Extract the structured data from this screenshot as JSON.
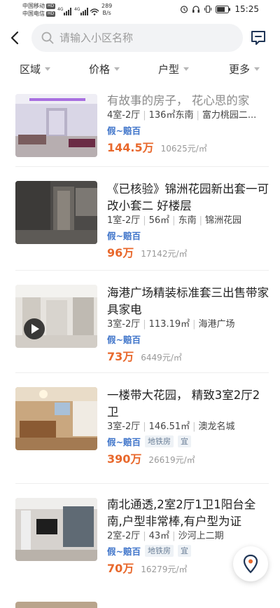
{
  "status_bar": {
    "carrier1": "中国移动",
    "carrier1_badge": "HD",
    "carrier2": "中国电信",
    "carrier2_badge": "HD",
    "net_speed_value": "289",
    "net_speed_unit": "B/s",
    "time": "15:25"
  },
  "search": {
    "placeholder": "请输入小区名称",
    "value": ""
  },
  "filters": [
    {
      "label": "区域"
    },
    {
      "label": "价格"
    },
    {
      "label": "户型"
    },
    {
      "label": "更多"
    }
  ],
  "listings": [
    {
      "title": "有故事的房子， 花心思的家",
      "layout": "4室-2厅",
      "area": "136㎡",
      "orientation": "东南",
      "community": "富力桃园二...",
      "guarantee": "假~赔百",
      "price": "144.5万",
      "unit_price": "10625元/㎡"
    },
    {
      "title": "《已核验》锦洲花园新出套一可改小套二 好楼层",
      "layout": "1室-2厅",
      "area": "56㎡",
      "orientation": "东南",
      "community": "锦洲花园",
      "guarantee": "假~赔百",
      "price": "96万",
      "unit_price": "17142元/㎡"
    },
    {
      "title": "海港广场精装标准套三出售带家具家电",
      "layout": "3室-2厅",
      "area": "113.19㎡",
      "community": "海港广场",
      "guarantee": "假~赔百",
      "price": "73万",
      "unit_price": "6449元/㎡",
      "has_video": true
    },
    {
      "title": "一楼带大花园， 精致3室2厅2卫",
      "layout": "3室-2厅",
      "area": "146.51㎡",
      "community": "澳龙名城",
      "guarantee": "假~赔百",
      "tag1": "地铁房",
      "tag2": "宜",
      "price": "390万",
      "unit_price": "26619元/㎡"
    },
    {
      "title": "南北通透,2室2厅1卫1阳台全南,户型非常棒,有户型为证",
      "layout": "2室-2厅",
      "area": "43㎡",
      "community": "沙河上二期",
      "guarantee": "假~赔百",
      "tag1": "地铁房",
      "tag2": "宜",
      "price": "70万",
      "unit_price": "16279元/㎡"
    }
  ],
  "colors": {
    "price": "#e8682c",
    "guarantee": "#3d73c9",
    "search_bg": "#f2f3f5"
  }
}
